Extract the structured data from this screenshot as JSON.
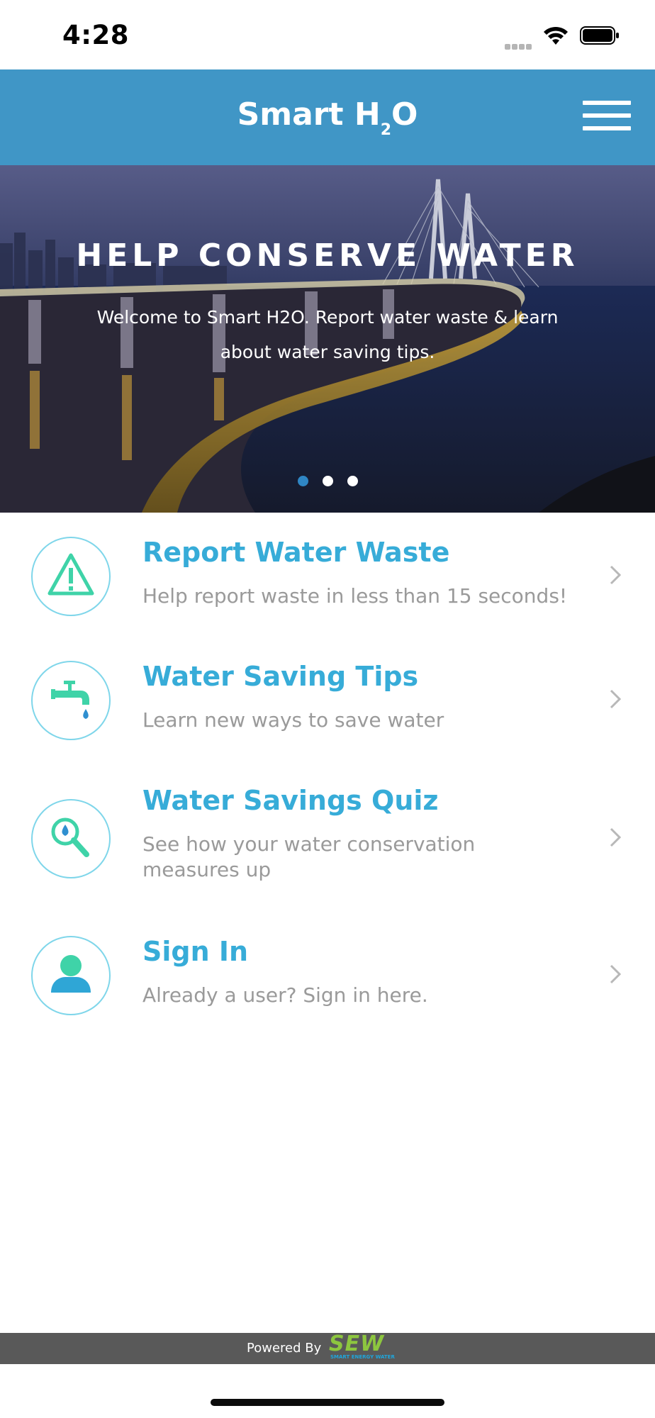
{
  "status_bar": {
    "time": "4:28"
  },
  "header": {
    "title_main": "Smart H",
    "title_sub": "2",
    "title_end": "O",
    "menu_icon": "hamburger-menu-icon"
  },
  "hero": {
    "title": "HELP CONSERVE WATER",
    "subtitle": "Welcome to Smart H2O. Report water waste & learn about water saving tips.",
    "slides": 3,
    "active_slide": 1
  },
  "menu": [
    {
      "title": "Report Water Waste",
      "description": "Help report waste in less than 15 seconds!",
      "icon": "warning-icon"
    },
    {
      "title": "Water Saving Tips",
      "description": "Learn new ways to save water",
      "icon": "faucet-icon"
    },
    {
      "title": "Water Savings Quiz",
      "description": "See how your water conservation measures up",
      "icon": "magnifier-icon"
    },
    {
      "title": "Sign In",
      "description": "Already a user? Sign in here.",
      "icon": "user-icon"
    }
  ],
  "footer": {
    "powered_by": "Powered By",
    "logo_text": "SEW",
    "logo_subtext": "SMART ENERGY WATER"
  },
  "colors": {
    "header": "#4096c6",
    "accent": "#37acd8",
    "icon_green": "#3fd3a8",
    "footer": "#595959",
    "logo_green": "#8dc63f"
  }
}
